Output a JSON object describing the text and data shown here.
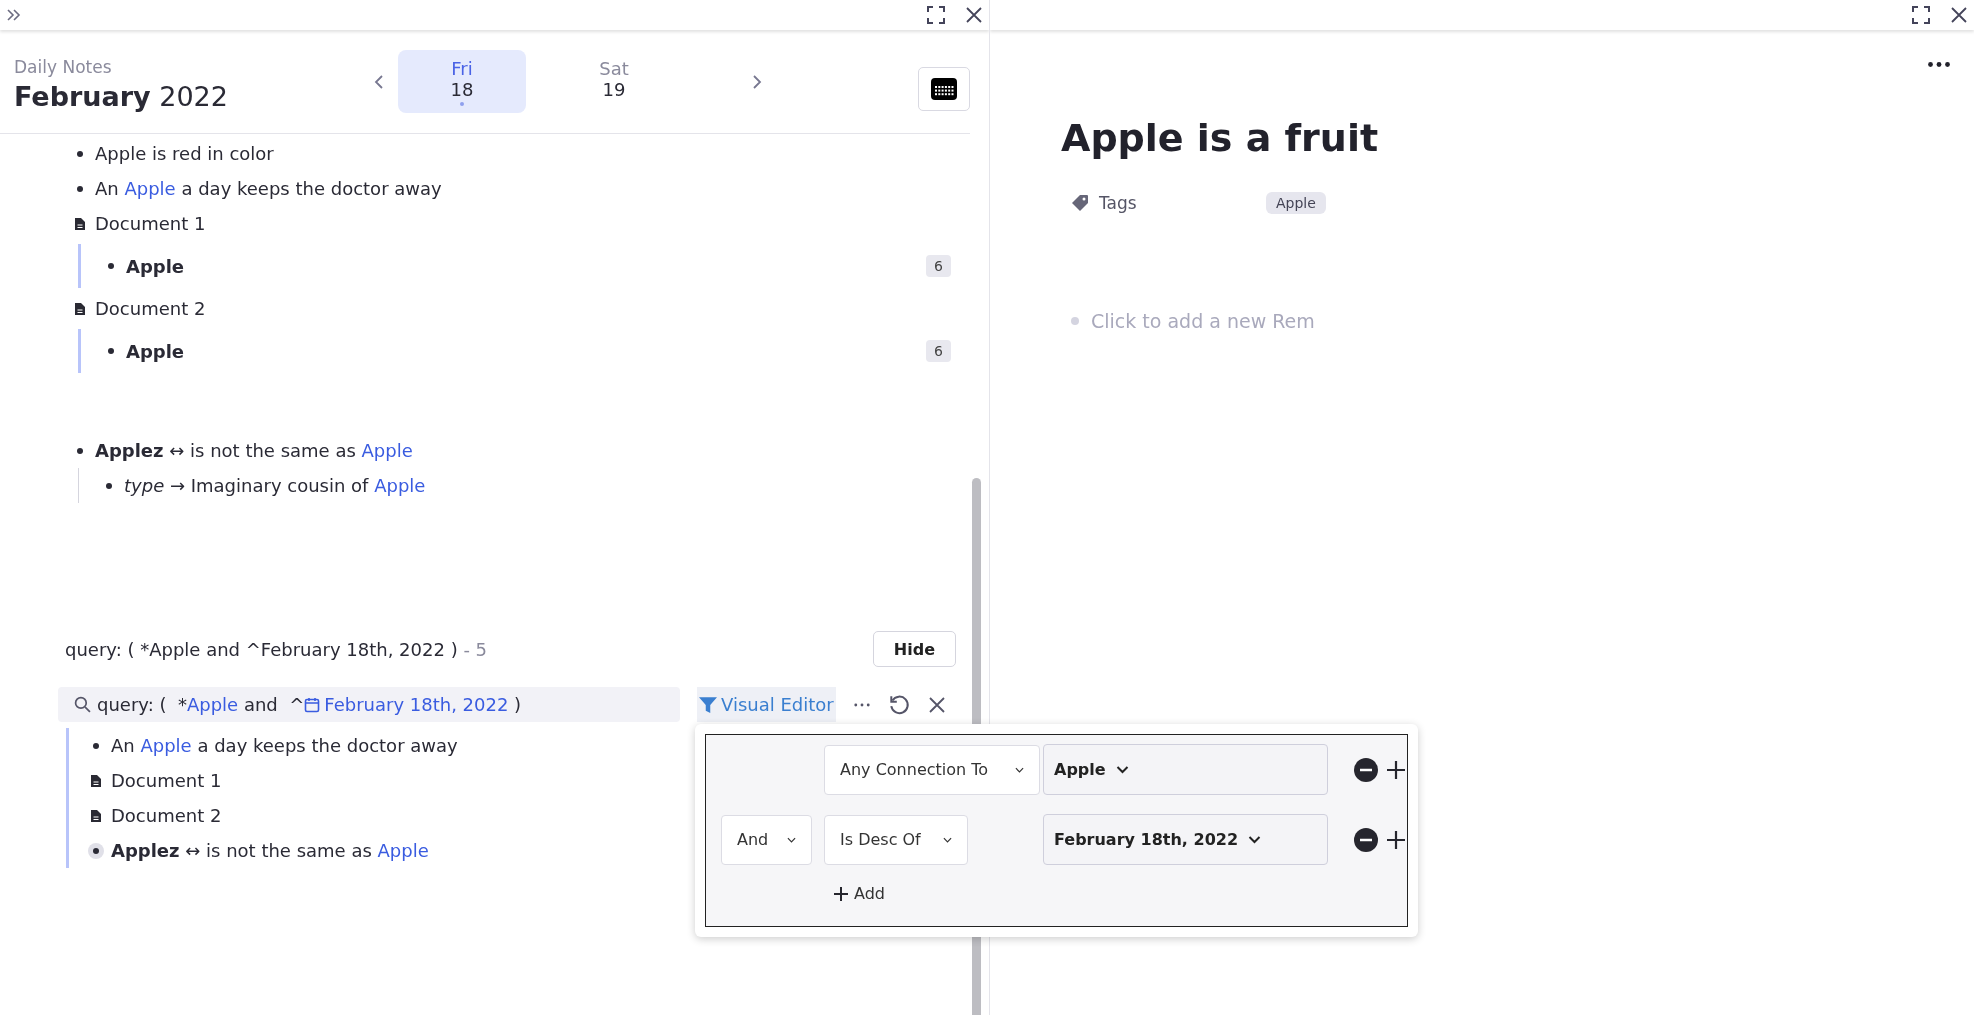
{
  "left_pane": {
    "header": {
      "subtitle": "Daily Notes",
      "month": "February",
      "year": "2022",
      "days": [
        {
          "weekday": "Fri",
          "date": "18",
          "selected": true,
          "has_notes": true
        },
        {
          "weekday": "Sat",
          "date": "19",
          "selected": false,
          "has_notes": false
        }
      ]
    },
    "items": [
      {
        "kind": "bullet",
        "segments": [
          {
            "text": "Apple is red in color",
            "kind": "text"
          }
        ]
      },
      {
        "kind": "bullet",
        "segments": [
          {
            "text": "An ",
            "kind": "text"
          },
          {
            "text": "Apple",
            "kind": "link"
          },
          {
            "text": " a day keeps the doctor away",
            "kind": "text"
          }
        ]
      },
      {
        "kind": "document",
        "segments": [
          {
            "text": "Document 1",
            "kind": "text"
          }
        ],
        "children": [
          {
            "kind": "bullet",
            "segments": [
              {
                "text": "Apple",
                "kind": "strong"
              }
            ],
            "count": "6"
          }
        ]
      },
      {
        "kind": "document",
        "segments": [
          {
            "text": "Document 2",
            "kind": "text"
          }
        ],
        "children": [
          {
            "kind": "bullet",
            "segments": [
              {
                "text": "Apple",
                "kind": "strong"
              }
            ],
            "count": "6"
          }
        ]
      },
      {
        "kind": "bullet",
        "segments": [
          {
            "text": "**Applez** ↔ is not the same as ",
            "kind": "text"
          },
          {
            "text": "Apple",
            "kind": "link"
          }
        ],
        "children": [
          {
            "kind": "bullet",
            "segments": [
              {
                "text": "*type* → Imaginary cousin of ",
                "kind": "text"
              },
              {
                "text": "Apple",
                "kind": "link"
              }
            ]
          }
        ]
      }
    ],
    "query": {
      "title": "query: ( *Apple and ^February 18th, 2022 )",
      "count": "- 5",
      "hide_button": "Hide",
      "search": [
        {
          "text": "query: (  *",
          "kind": "plain"
        },
        {
          "text": "Apple",
          "kind": "link"
        },
        {
          "text": " and  ^",
          "kind": "plain"
        },
        {
          "text": "February 18th, 2022",
          "kind": "date_link"
        },
        {
          "text": " )",
          "kind": "plain"
        }
      ],
      "visual_editor": "Visual Editor",
      "results": [
        {
          "kind": "bullet",
          "segments": [
            {
              "text": "An ",
              "kind": "text"
            },
            {
              "text": "Apple",
              "kind": "link"
            },
            {
              "text": " a day keeps the doctor away",
              "kind": "text"
            }
          ]
        },
        {
          "kind": "document",
          "segments": [
            {
              "text": "Document 1",
              "kind": "text"
            }
          ]
        },
        {
          "kind": "document",
          "segments": [
            {
              "text": "Document 2",
              "kind": "text"
            }
          ]
        },
        {
          "kind": "reference",
          "segments": [
            {
              "text": "**Applez** ↔ is not the same as ",
              "kind": "text"
            },
            {
              "text": "Apple",
              "kind": "link"
            }
          ]
        }
      ]
    },
    "filter_editor": {
      "rows": [
        {
          "relation": "Any Connection To",
          "target": "Apple"
        },
        {
          "conjunction": "And",
          "relation": "Is Desc Of",
          "target": "February 18th, 2022"
        }
      ],
      "add_button": "Add"
    }
  },
  "right_pane": {
    "title": "Apple is a fruit",
    "property": "Tags",
    "tags": [
      "Apple"
    ],
    "placeholder": "Click to add a new Rem"
  }
}
